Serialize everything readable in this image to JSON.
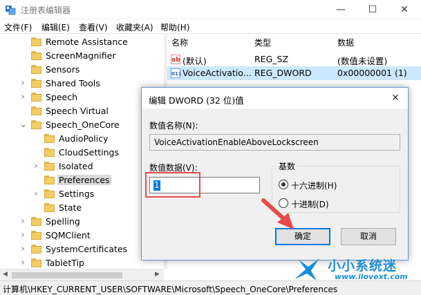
{
  "window": {
    "title": "注册表编辑器",
    "min_glyph": "—",
    "max_glyph": "☐",
    "close_glyph": "✕"
  },
  "menu": [
    "文件(F)",
    "编辑(E)",
    "查看(V)",
    "收藏夹(A)",
    "帮助(H)"
  ],
  "tree": [
    {
      "label": "Remote Assistance",
      "expandable": false,
      "indent": 0
    },
    {
      "label": "ScreenMagnifier",
      "expandable": false,
      "indent": 0
    },
    {
      "label": "Sensors",
      "expandable": false,
      "indent": 0
    },
    {
      "label": "Shared Tools",
      "expandable": true,
      "indent": 0
    },
    {
      "label": "Speech",
      "expandable": true,
      "indent": 0
    },
    {
      "label": "Speech Virtual",
      "expandable": false,
      "indent": 0
    },
    {
      "label": "Speech_OneCore",
      "expandable": true,
      "expanded": true,
      "indent": 0
    },
    {
      "label": "AudioPolicy",
      "expandable": false,
      "indent": 1
    },
    {
      "label": "CloudSettings",
      "expandable": false,
      "indent": 1
    },
    {
      "label": "Isolated",
      "expandable": true,
      "indent": 1
    },
    {
      "label": "Preferences",
      "expandable": false,
      "indent": 1,
      "selected": true
    },
    {
      "label": "Settings",
      "expandable": true,
      "indent": 1
    },
    {
      "label": "State",
      "expandable": false,
      "indent": 1
    },
    {
      "label": "Spelling",
      "expandable": true,
      "indent": 0
    },
    {
      "label": "SQMClient",
      "expandable": true,
      "indent": 0
    },
    {
      "label": "SystemCertificates",
      "expandable": true,
      "indent": 0
    },
    {
      "label": "TabletTip",
      "expandable": true,
      "indent": 0
    }
  ],
  "values_pane": {
    "headers": {
      "name": "名称",
      "type": "类型",
      "data": "数据"
    },
    "rows": [
      {
        "icon": "ab",
        "name": "(默认)",
        "type": "REG_SZ",
        "data": "(数值未设置)"
      },
      {
        "icon": "011",
        "name": "VoiceActivatio...",
        "type": "REG_DWORD",
        "data": "0x00000001 (1)",
        "selected": true
      }
    ]
  },
  "status_path": "计算机\\HKEY_CURRENT_USER\\SOFTWARE\\Microsoft\\Speech_OneCore\\Preferences",
  "dialog": {
    "title": "编辑 DWORD (32 位)值",
    "name_label": "数值名称(N):",
    "name_value": "VoiceActivationEnableAboveLockscreen",
    "data_label": "数值数据(V):",
    "data_value": "1",
    "base_label": "基数",
    "hex_label": "十六进制(H)",
    "dec_label": "十进制(D)",
    "hex_selected": true,
    "ok_label": "确定",
    "cancel_label": "取消"
  },
  "watermark": {
    "line1": "小小系统迷",
    "line2": "www.ilovext.com"
  },
  "colors": {
    "selection_row": "#cce8ff",
    "annotation_red": "#e84b4b",
    "accent_blue": "#0078d7",
    "watermark_blue": "#1a8fd8"
  }
}
